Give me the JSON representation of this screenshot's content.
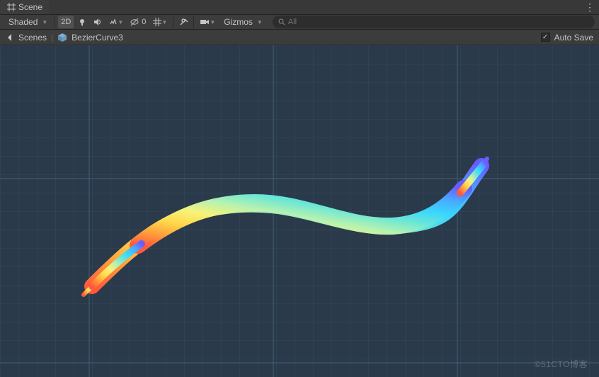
{
  "tab": {
    "label": "Scene"
  },
  "toolbar": {
    "render_mode": "Shaded",
    "btn_2d": "2D",
    "hidden_count": "0",
    "gizmos_label": "Gizmos"
  },
  "search": {
    "placeholder": "All",
    "value": ""
  },
  "breadcrumb": {
    "root": "Scenes",
    "item": "BezierCurve3"
  },
  "autosave": {
    "label": "Auto Save",
    "checked": true
  },
  "watermark": "©51CTO博客",
  "colors": {
    "viewport_bg": "#2a3a4a",
    "grid_minor": "#334a5f",
    "grid_major": "#44607a"
  }
}
